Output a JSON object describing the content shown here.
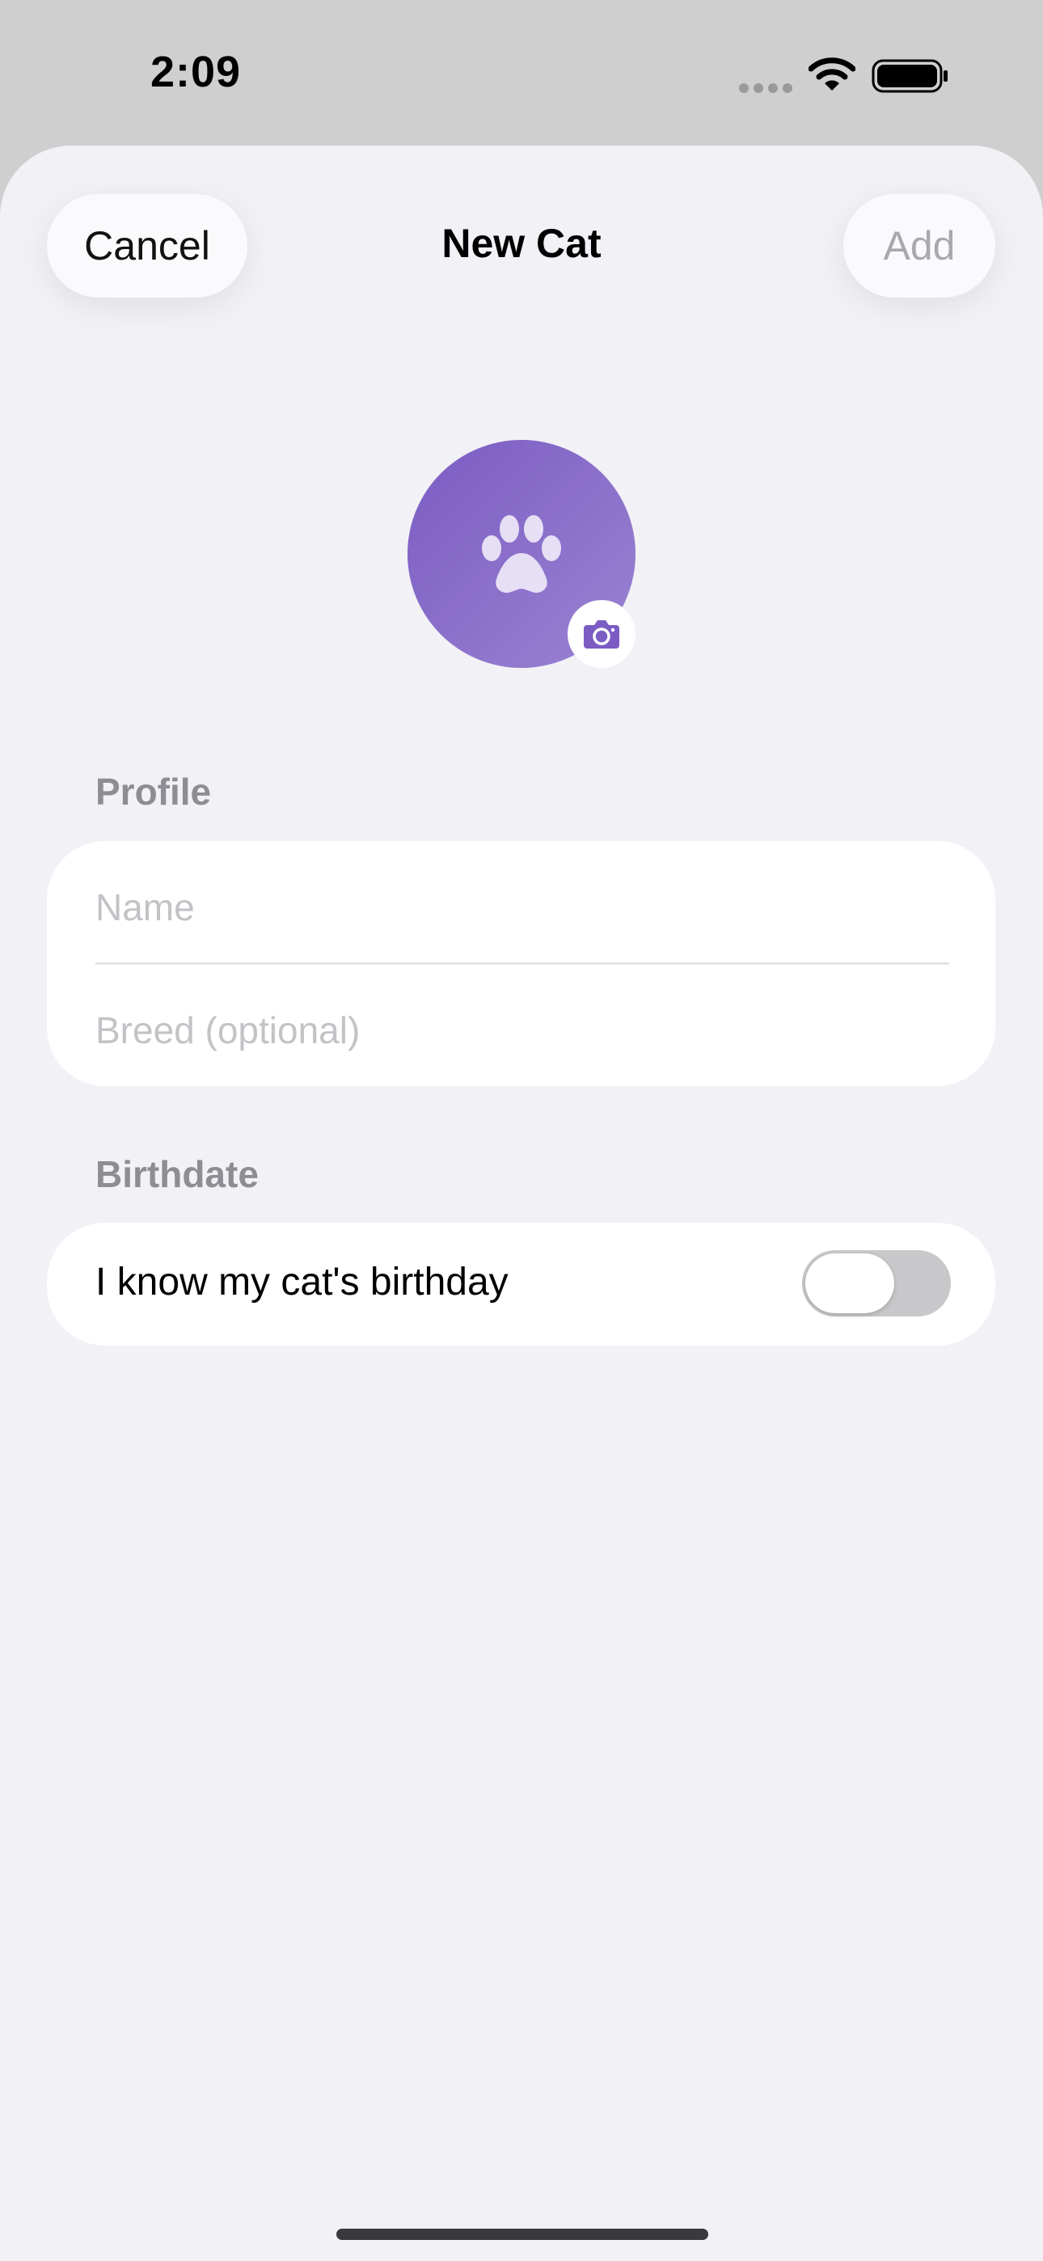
{
  "status_bar": {
    "time": "2:09"
  },
  "nav": {
    "cancel_label": "Cancel",
    "title": "New Cat",
    "add_label": "Add"
  },
  "avatar": {
    "icon": "paw-icon",
    "badge_icon": "camera-icon",
    "gradient_start": "#7b5cc3",
    "gradient_end": "#9b83d2"
  },
  "profile": {
    "header": "Profile",
    "name_value": "",
    "name_placeholder": "Name",
    "breed_value": "",
    "breed_placeholder": "Breed (optional)"
  },
  "birthdate": {
    "header": "Birthdate",
    "toggle_label": "I know my cat's birthday",
    "toggle_on": false
  },
  "colors": {
    "accent": "#7b5cc3",
    "background": "#f2f1f6",
    "section_header": "#8e8d93",
    "disabled_text": "#a9a9ad"
  }
}
